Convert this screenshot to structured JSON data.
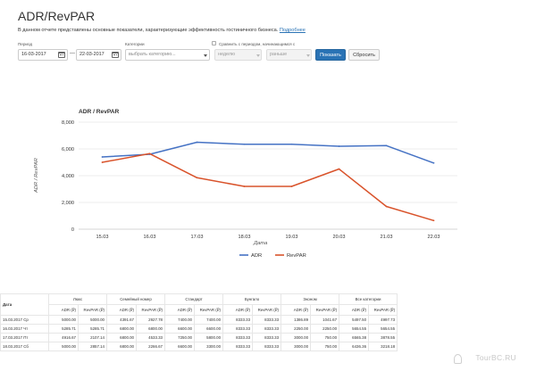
{
  "page": {
    "title": "ADR/RevPAR",
    "description": "В данном отчете представлены основные показатели, характеризующие эффективность гостиничного бизнеса.",
    "more_link": "Подробнее"
  },
  "filters": {
    "period_label": "Период",
    "date_from": "16-03-2017",
    "date_separator": "—",
    "date_to": "22-03-2017",
    "category_label": "Категории",
    "category_placeholder": "выбрать категорию...",
    "compare_label": "Сравнить с периодом, начинающимся с",
    "compare_unit": "неделю",
    "compare_direction": "раньше",
    "show_button": "Показать",
    "reset_button": "Сбросить"
  },
  "chart_data": {
    "type": "line",
    "title": "ADR / RevPAR",
    "categories": [
      "15.03",
      "16.03",
      "17.03",
      "18.03",
      "19.03",
      "20.03",
      "21.03",
      "22.03"
    ],
    "series": [
      {
        "name": "ADR",
        "color": "#4572c4",
        "values": [
          5400,
          5600,
          6500,
          6350,
          6350,
          6200,
          6250,
          4950
        ]
      },
      {
        "name": "RevPAR",
        "color": "#d9532b",
        "values": [
          5000,
          5650,
          3850,
          3200,
          3200,
          4500,
          1700,
          650
        ]
      }
    ],
    "xlabel": "Дата",
    "ylabel": "ADR / RevPAR",
    "y_ticks": [
      "0",
      "2,000",
      "4,000",
      "6,000",
      "8,000"
    ],
    "ylim": [
      0,
      8000
    ],
    "grid": true,
    "legend_placement": "bottom"
  },
  "table": {
    "date_header": "Дата",
    "groups": [
      "Люкс",
      "Семейный номер",
      "Стандарт",
      "Бунгало",
      "Эконом",
      "Все категории"
    ],
    "sub_headers": [
      "ADR (₽)",
      "RevPAR (₽)"
    ],
    "rows": [
      {
        "date": "15.03.2017 Ср",
        "values": [
          "5000.00",
          "5000.00",
          "4391.67",
          "2927.78",
          "7400.00",
          "7400.00",
          "8333.33",
          "8333.33",
          "1386.89",
          "1041.67",
          "5497.50",
          "4997.73"
        ]
      },
      {
        "date": "16.03.2017 Чт",
        "values": [
          "5285.71",
          "5285.71",
          "6800.00",
          "6800.00",
          "6600.00",
          "6600.00",
          "8333.33",
          "8333.33",
          "2250.00",
          "2250.00",
          "5654.55",
          "5654.55"
        ]
      },
      {
        "date": "17.03.2017 Пт",
        "values": [
          "4916.67",
          "2107.14",
          "6800.00",
          "4533.33",
          "7250.00",
          "5800.00",
          "8333.33",
          "8333.33",
          "3000.00",
          "750.00",
          "6565.38",
          "3878.55"
        ]
      },
      {
        "date": "18.03.2017 Сб",
        "values": [
          "5000.00",
          "2857.14",
          "6800.00",
          "2266.67",
          "6600.00",
          "3300.00",
          "8333.33",
          "8333.33",
          "3000.00",
          "750.00",
          "6436.36",
          "3218.18"
        ]
      }
    ]
  },
  "watermark": "TourBC.RU"
}
